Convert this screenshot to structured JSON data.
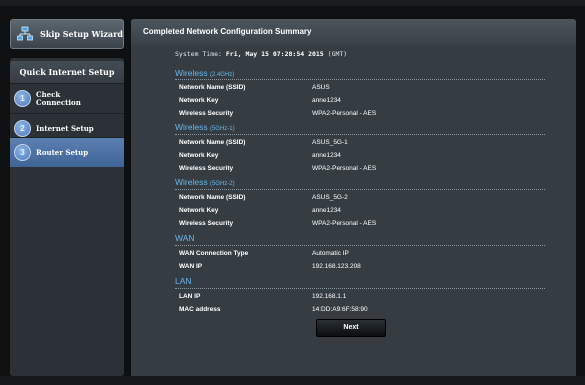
{
  "sidebar": {
    "skip_label": "Skip Setup Wizard",
    "qis_title": "Quick Internet Setup",
    "steps": [
      {
        "number": "1",
        "label_line1": "Check",
        "label_line2": "Connection",
        "active": false
      },
      {
        "number": "2",
        "label_line1": "Internet Setup",
        "label_line2": "",
        "active": false
      },
      {
        "number": "3",
        "label_line1": "Router Setup",
        "label_line2": "",
        "active": true
      }
    ]
  },
  "main": {
    "header": "Completed Network Configuration Summary",
    "system_time_label": "System Time:",
    "system_time_value": "Fri, May 15 07:28:54 2015",
    "system_time_zone": "(GMT)",
    "sections": [
      {
        "title": "Wireless",
        "subtitle": "(2.4GHz)",
        "rows": [
          {
            "label": "Network Name (SSID)",
            "value": "ASUS"
          },
          {
            "label": "Network Key",
            "value": "anne1234"
          },
          {
            "label": "Wireless Security",
            "value": "WPA2-Personal - AES"
          }
        ]
      },
      {
        "title": "Wireless",
        "subtitle": "(5GHz-1)",
        "rows": [
          {
            "label": "Network Name (SSID)",
            "value": "ASUS_5G-1"
          },
          {
            "label": "Network Key",
            "value": "anne1234"
          },
          {
            "label": "Wireless Security",
            "value": "WPA2-Personal - AES"
          }
        ]
      },
      {
        "title": "Wireless",
        "subtitle": "(5GHz-2)",
        "rows": [
          {
            "label": "Network Name (SSID)",
            "value": "ASUS_5G-2"
          },
          {
            "label": "Network Key",
            "value": "anne1234"
          },
          {
            "label": "Wireless Security",
            "value": "WPA2-Personal - AES"
          }
        ]
      },
      {
        "title": "WAN",
        "subtitle": "",
        "rows": [
          {
            "label": "WAN Connection Type",
            "value": "Automatic IP"
          },
          {
            "label": "WAN IP",
            "value": "192.168.123.208"
          }
        ]
      },
      {
        "title": "LAN",
        "subtitle": "",
        "rows": [
          {
            "label": "LAN IP",
            "value": "192.168.1.1"
          },
          {
            "label": "MAC address",
            "value": "14:DD:A9:6F:58:90"
          }
        ]
      }
    ],
    "next_label": "Next"
  },
  "icons": {
    "skip": "network-wizard-icon"
  }
}
